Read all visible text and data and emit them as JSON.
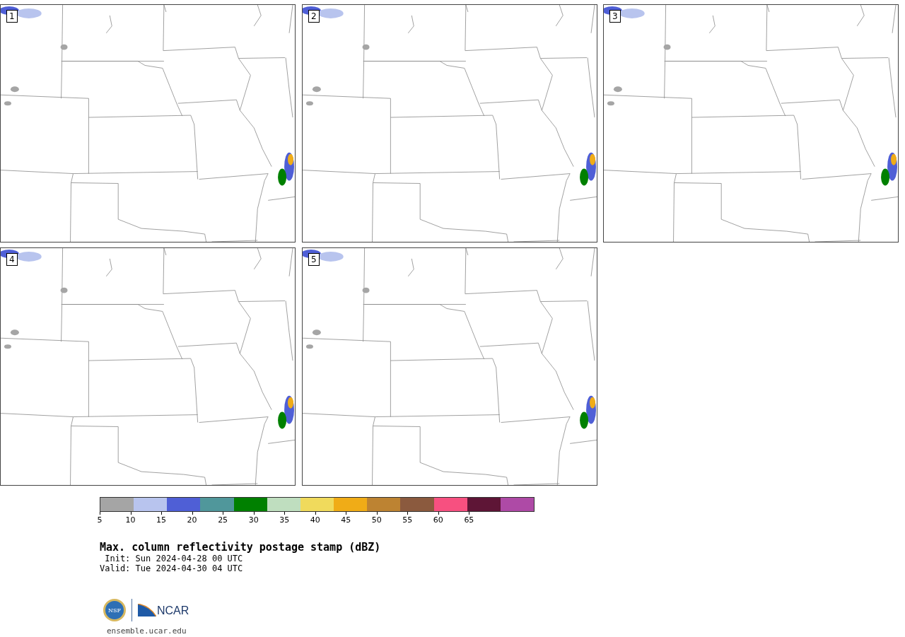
{
  "panels": [
    {
      "label": "1"
    },
    {
      "label": "2"
    },
    {
      "label": "3"
    },
    {
      "label": "4"
    },
    {
      "label": "5"
    }
  ],
  "colorbar": {
    "segments": [
      {
        "color": "#a5a5a5"
      },
      {
        "color": "#b8c4ee"
      },
      {
        "color": "#4f5fd6"
      },
      {
        "color": "#50979b"
      },
      {
        "color": "#008000"
      },
      {
        "color": "#bfdebf"
      },
      {
        "color": "#f0da5c"
      },
      {
        "color": "#f0ac17"
      },
      {
        "color": "#bd8332"
      },
      {
        "color": "#8b5a3e"
      },
      {
        "color": "#f75080"
      },
      {
        "color": "#5e1536"
      },
      {
        "color": "#ae4aa6"
      }
    ],
    "ticks": [
      "5",
      "10",
      "15",
      "20",
      "25",
      "30",
      "35",
      "40",
      "45",
      "50",
      "55",
      "60",
      "65"
    ]
  },
  "title": "Max. column reflectivity postage stamp (dBZ)",
  "init": " Init: Sun 2024-04-28 00 UTC",
  "valid": "Valid: Tue 2024-04-30 04 UTC",
  "logos": {
    "seal": "NSF",
    "wordmark": "NCAR"
  },
  "footer": "ensemble.ucar.edu"
}
